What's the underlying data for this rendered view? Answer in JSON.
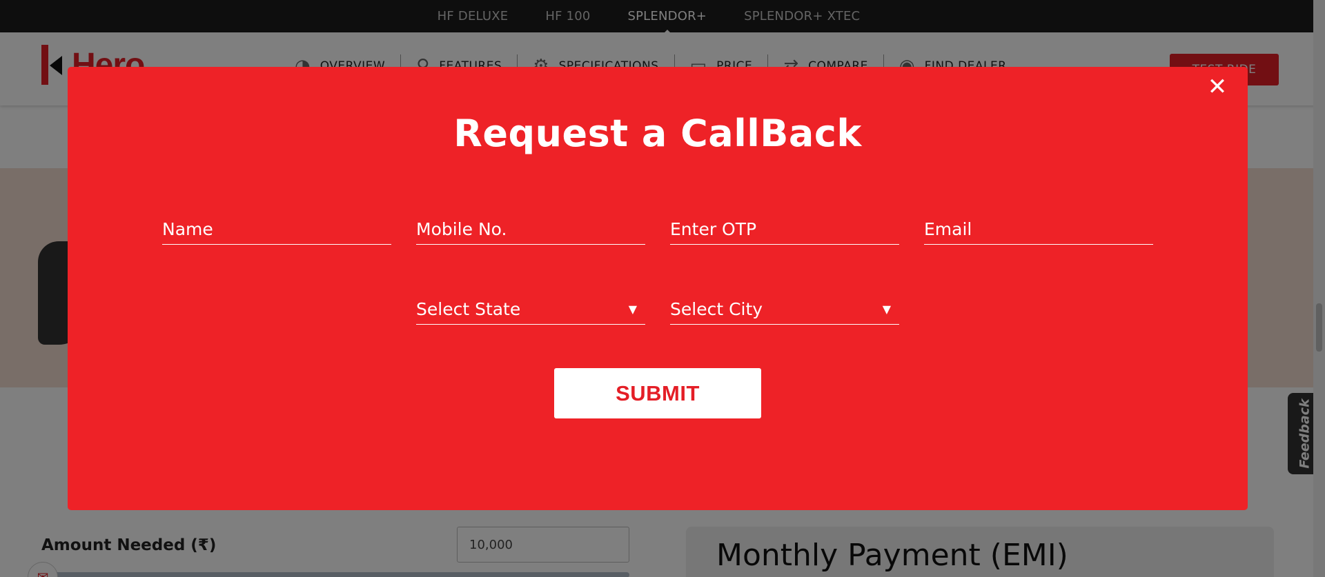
{
  "model_bar": {
    "items": [
      {
        "label": "HF DELUXE",
        "active": false
      },
      {
        "label": "HF 100",
        "active": false
      },
      {
        "label": "SPLENDOR+",
        "active": true
      },
      {
        "label": "SPLENDOR+ XTEC",
        "active": false
      }
    ]
  },
  "header": {
    "logo_text": "Hero",
    "nav": [
      {
        "label": "OVERVIEW",
        "icon": "speedometer-icon"
      },
      {
        "label": "FEATURES",
        "icon": "bike-icon"
      },
      {
        "label": "SPECIFICATIONS",
        "icon": "gear-icon"
      },
      {
        "label": "PRICE",
        "icon": "wallet-icon"
      },
      {
        "label": "COMPARE",
        "icon": "compare-icon"
      },
      {
        "label": "FIND DEALER",
        "icon": "location-pin-icon"
      }
    ],
    "cta_label": "TEST RIDE"
  },
  "background": {
    "amount_label": "Amount Needed (₹)",
    "amount_value": "10,000",
    "emi_title": "Monthly Payment (EMI)",
    "feedback_label": "Feedback"
  },
  "modal": {
    "title": "Request a CallBack",
    "close_icon": "close-icon",
    "fields": {
      "name_placeholder": "Name",
      "mobile_placeholder": "Mobile No.",
      "otp_placeholder": "Enter OTP",
      "email_placeholder": "Email"
    },
    "state_select": "Select State",
    "city_select": "Select City",
    "submit_label": "SUBMIT"
  },
  "colors": {
    "modal_red": "#ee2227",
    "brand_red": "#e41e26",
    "top_bar": "#1c1c1c"
  }
}
